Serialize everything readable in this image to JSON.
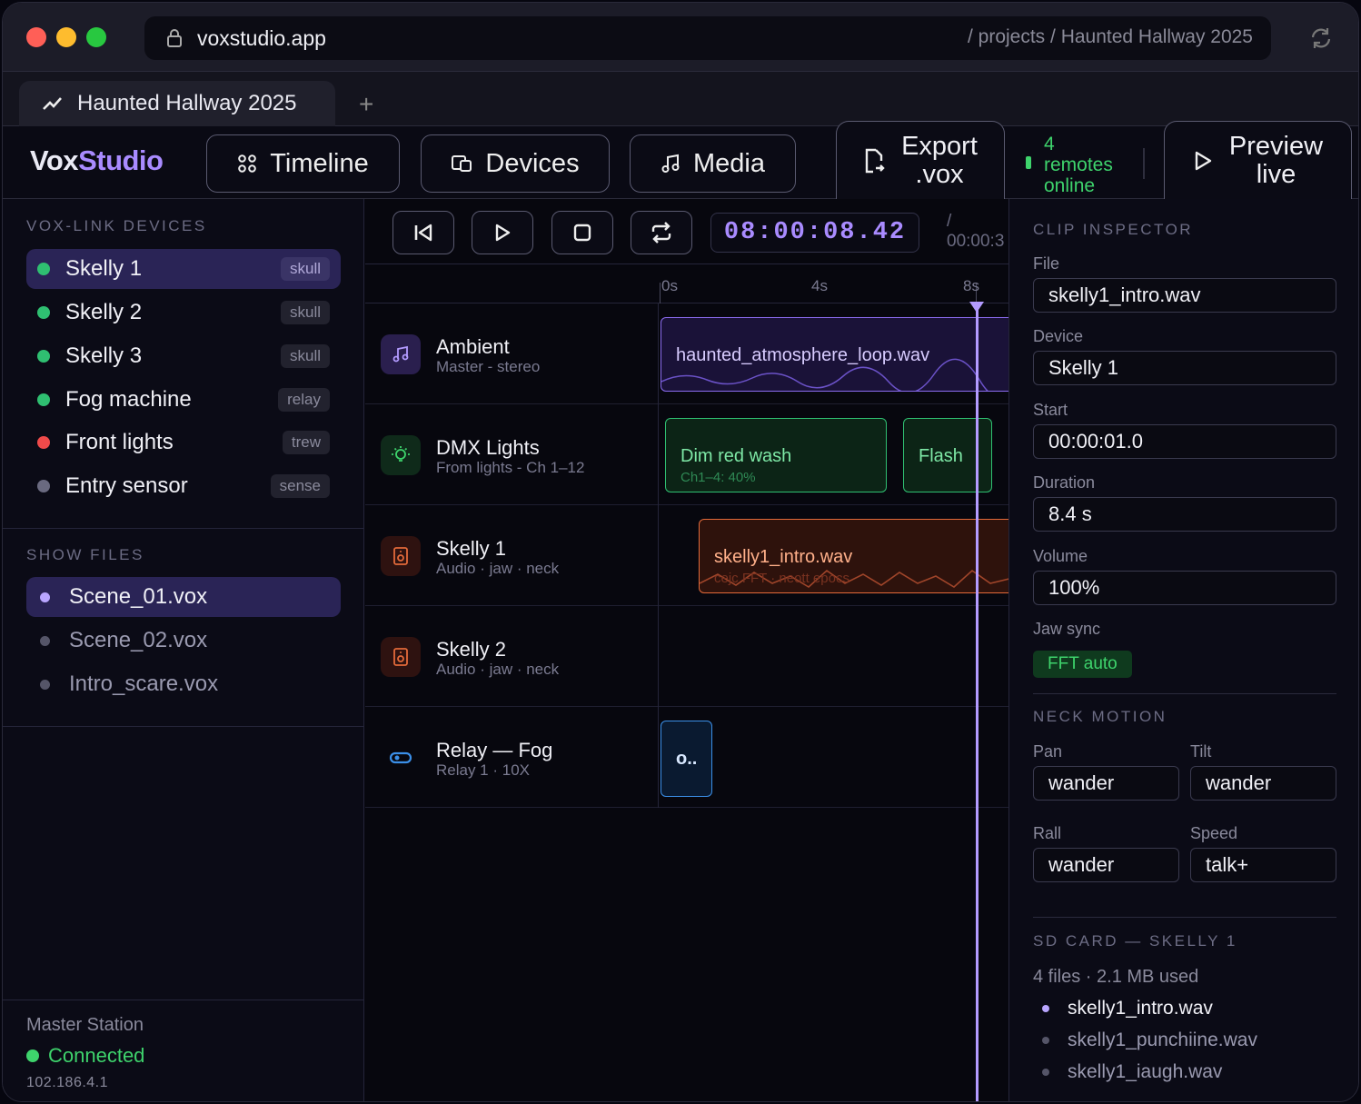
{
  "browser": {
    "host": "voxstudio.app",
    "path": "/ projects / Haunted Hallway 2025",
    "tab_title": "Haunted Hallway 2025",
    "new_tab": "+"
  },
  "app": {
    "logo_vox": "Vox",
    "logo_studio": "Studio",
    "nav": {
      "timeline": "Timeline",
      "devices": "Devices",
      "media": "Media"
    },
    "export_line1": "Export",
    "export_line2": ".vox",
    "remotes_count": "4",
    "remotes_line1": "remotes",
    "remotes_line2": "online",
    "preview_line1": "Preview",
    "preview_line2": "live"
  },
  "sidebar": {
    "devices_heading": "VOX-LINK DEVICES",
    "devices": [
      {
        "name": "Skelly 1",
        "type": "skull",
        "status_color": "#2fbf71"
      },
      {
        "name": "Skelly 2",
        "type": "skull",
        "status_color": "#2fbf71"
      },
      {
        "name": "Skelly 3",
        "type": "skull",
        "status_color": "#2fbf71"
      },
      {
        "name": "Fog machine",
        "type": "relay",
        "status_color": "#2fbf71"
      },
      {
        "name": "Front lights",
        "type": "trew",
        "status_color": "#ef4a4a"
      },
      {
        "name": "Entry sensor",
        "type": "sense",
        "status_color": "#6a6a80"
      }
    ],
    "files_heading": "SHOW FILES",
    "files": [
      "Scene_01.vox",
      "Scene_02.vox",
      "Intro_scare.vox"
    ],
    "master_title": "Master Station",
    "master_status": "Connected",
    "master_ip": "102.186.4.1"
  },
  "transport": {
    "timecode": "08:00:08.42",
    "total_sep": "/",
    "total": "00:00:3"
  },
  "ruler": [
    "0s",
    "4s",
    "8s"
  ],
  "tracks": [
    {
      "name": "Ambient",
      "sub": "Master - stereo",
      "icon": "music-note-icon"
    },
    {
      "name": "DMX Lights",
      "sub": "From lights - Ch 1–12",
      "icon": "bulb-icon"
    },
    {
      "name": "Skelly 1",
      "sub": "Audio · jaw · neck",
      "icon": "speaker-icon"
    },
    {
      "name": "Skelly 2",
      "sub": "Audio · jaw · neck",
      "icon": "speaker-icon"
    },
    {
      "name": "Relay — Fog",
      "sub": "Relay 1 · 10X",
      "icon": "toggle-icon"
    }
  ],
  "clips": {
    "ambient": "haunted_atmosphere_loop.wav",
    "dmx_a_title": "Dim red wash",
    "dmx_a_sub": "Ch1–4: 40%",
    "dmx_b_title": "Flash",
    "skelly1_title": "skelly1_intro.wav",
    "skelly1_sub": "cejc FFT · neott epocs",
    "relay_title": "o.."
  },
  "inspector": {
    "heading": "CLIP INSPECTOR",
    "file_label": "File",
    "file": "skelly1_intro.wav",
    "device_label": "Device",
    "device": "Skelly 1",
    "start_label": "Start",
    "start": "00:00:01.0",
    "duration_label": "Duration",
    "duration": "8.4 s",
    "volume_label": "Volume",
    "volume": "100%",
    "jaw_label": "Jaw sync",
    "jaw": "FFT auto",
    "neck_heading": "NECK MOTION",
    "pan_label": "Pan",
    "pan": "wander",
    "tilt_label": "Tilt",
    "tilt": "wander",
    "roll_label": "Rall",
    "roll": "wander",
    "speed_label": "Speed",
    "speed": "talk+",
    "sd_heading": "SD CARD — SKELLY 1",
    "sd_summary": "4 files · 2.1 MB used",
    "sd_files": [
      "skelly1_intro.wav",
      "skelly1_punchiine.wav",
      "skelly1_iaugh.wav"
    ]
  },
  "colors": {
    "accent": "#a98bff",
    "green": "#3ed36c",
    "red": "#ef4a4a",
    "ambient_clip": "#8b6cf0",
    "dmx_clip": "#2fbf71",
    "skelly_clip": "#e36a3a",
    "relay_clip": "#3b8fe8"
  }
}
